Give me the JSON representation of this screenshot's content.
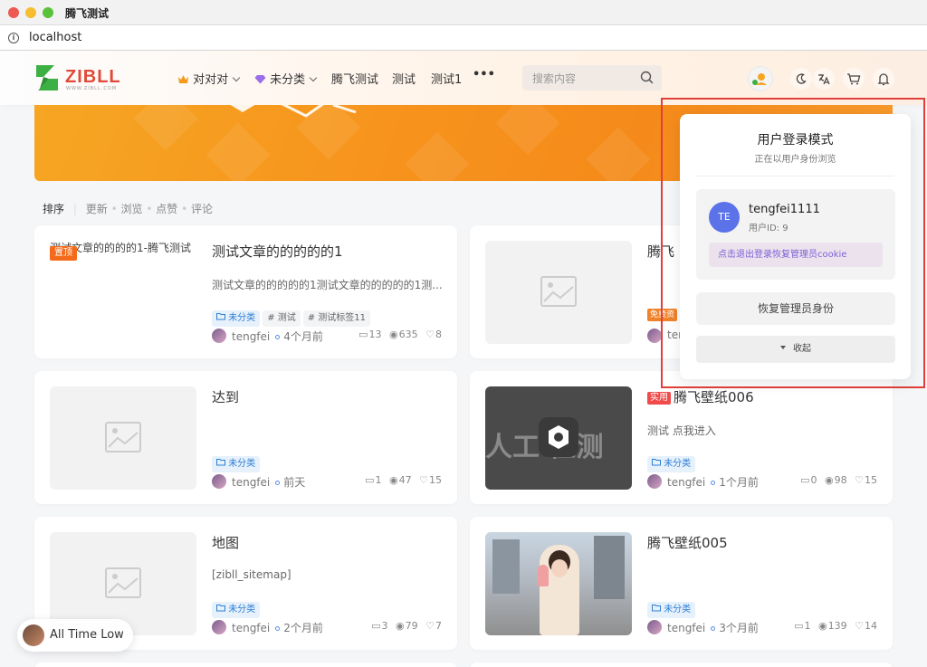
{
  "window": {
    "title": "腾飞测试"
  },
  "address_bar": {
    "url": "localhost"
  },
  "header": {
    "logo_text": "ZIBLL",
    "logo_sub": "WWW.ZIBLL.COM",
    "nav": [
      "对对对",
      "未分类",
      "腾飞测试",
      "测试",
      "测试1",
      "•••"
    ],
    "search_placeholder": "搜索内容"
  },
  "sort": {
    "label": "排序",
    "options": [
      "更新",
      "浏览",
      "点赞",
      "评论"
    ]
  },
  "posts": [
    {
      "title": "测试文章的的的的的1",
      "thumb_text": "测试文章的的的的1-腾飞测试",
      "badge": "置顶",
      "excerpt": "测试文章的的的的的1测试文章的的的的的1测...",
      "tags": [
        "未分类",
        "# 测试",
        "# 测试标签11"
      ],
      "author": "tengfei",
      "time": "4个月前",
      "comments": "13",
      "views": "635",
      "likes": "8"
    },
    {
      "title": "达到",
      "tags": [
        "未分类"
      ],
      "author": "tengfei",
      "time": "前天",
      "comments": "1",
      "views": "47",
      "likes": "15"
    },
    {
      "title": "腾飞壁纸006",
      "badge": "实用",
      "thumb_text": "人工 检测",
      "excerpt": "测试 点我进入",
      "tags": [
        "未分类"
      ],
      "author": "tengfei",
      "time": "1个月前",
      "comments": "0",
      "views": "98",
      "likes": "15"
    },
    {
      "title": "地图",
      "excerpt": "[zibll_sitemap]",
      "tags": [
        "未分类"
      ],
      "author": "tengfei",
      "time": "2个月前",
      "comments": "3",
      "views": "79",
      "likes": "7"
    },
    {
      "title": "腾飞壁纸005",
      "tags": [
        "未分类"
      ],
      "author": "tengfei",
      "time": "3个月前",
      "comments": "1",
      "views": "139",
      "likes": "14"
    },
    {
      "title": "腾飞",
      "badge": "免费资",
      "author": "ten"
    }
  ],
  "popup": {
    "title": "用户登录模式",
    "subtitle": "正在以用户身份浏览",
    "avatar_initials": "TE",
    "username": "tengfei1111",
    "user_id": "用户ID: 9",
    "logout_link": "点击退出登录恢复管理员cookie",
    "restore_button": "恢复管理员身份",
    "collapse_button": "收起"
  },
  "floating_widget": {
    "label": "All Time Low"
  },
  "colors": {
    "accent": "#f7941d",
    "highlight_border": "#e0403a",
    "link_purple": "#7b61d6",
    "avatar_blue": "#5b72e8"
  }
}
